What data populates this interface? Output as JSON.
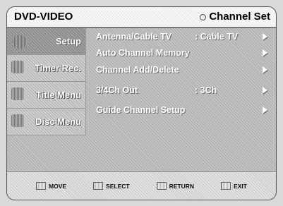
{
  "header": {
    "app_title": "DVD-VIDEO",
    "page_title": "Channel Set"
  },
  "sidebar": {
    "items": [
      {
        "label": "Setup",
        "active": true
      },
      {
        "label": "Timer Rec.",
        "active": false
      },
      {
        "label": "Title Menu",
        "active": false
      },
      {
        "label": "Disc Menu",
        "active": false
      }
    ]
  },
  "menu": {
    "rows": [
      {
        "label": "Antenna/Cable TV",
        "value": ": Cable TV"
      },
      {
        "label": "Auto Channel Memory",
        "value": ""
      },
      {
        "label": "Channel Add/Delete",
        "value": ""
      },
      {
        "label": "3/4Ch Out",
        "value": ": 3Ch"
      },
      {
        "label": "Guide Channel Setup",
        "value": ""
      }
    ]
  },
  "footer": {
    "hints": [
      {
        "label": "MOVE",
        "icon": "move-key-icon"
      },
      {
        "label": "SELECT",
        "icon": "select-key-icon"
      },
      {
        "label": "RETURN",
        "icon": "return-key-icon"
      },
      {
        "label": "EXIT",
        "icon": "exit-key-icon"
      }
    ]
  }
}
